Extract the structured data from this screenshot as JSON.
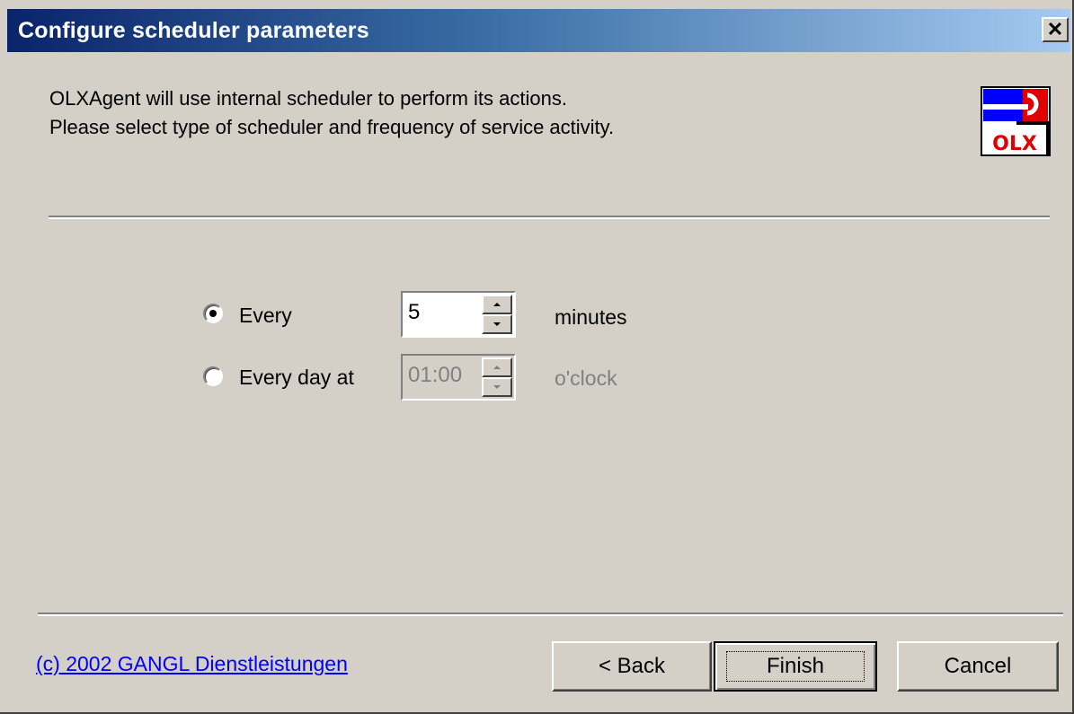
{
  "window": {
    "title": "Configure scheduler parameters",
    "close_label": "✕"
  },
  "description": {
    "line1": "OLXAgent will use internal scheduler to perform its actions.",
    "line2": "Please select type of scheduler and frequency of service activity."
  },
  "logo": {
    "text": "OLX",
    "icon": "olx-wrench-logo",
    "colors": {
      "blue": "#0000ff",
      "red": "#e00000",
      "black": "#000000"
    }
  },
  "scheduler": {
    "option_every": {
      "label": "Every",
      "selected": true,
      "value": "5",
      "unit": "minutes"
    },
    "option_daily": {
      "label": "Every day at",
      "selected": false,
      "value": "01:00",
      "unit": "o'clock"
    }
  },
  "footer": {
    "copyright_link": "(c) 2002 GANGL Dienstleistungen",
    "back_label": "< Back",
    "finish_label": "Finish",
    "cancel_label": "Cancel"
  }
}
